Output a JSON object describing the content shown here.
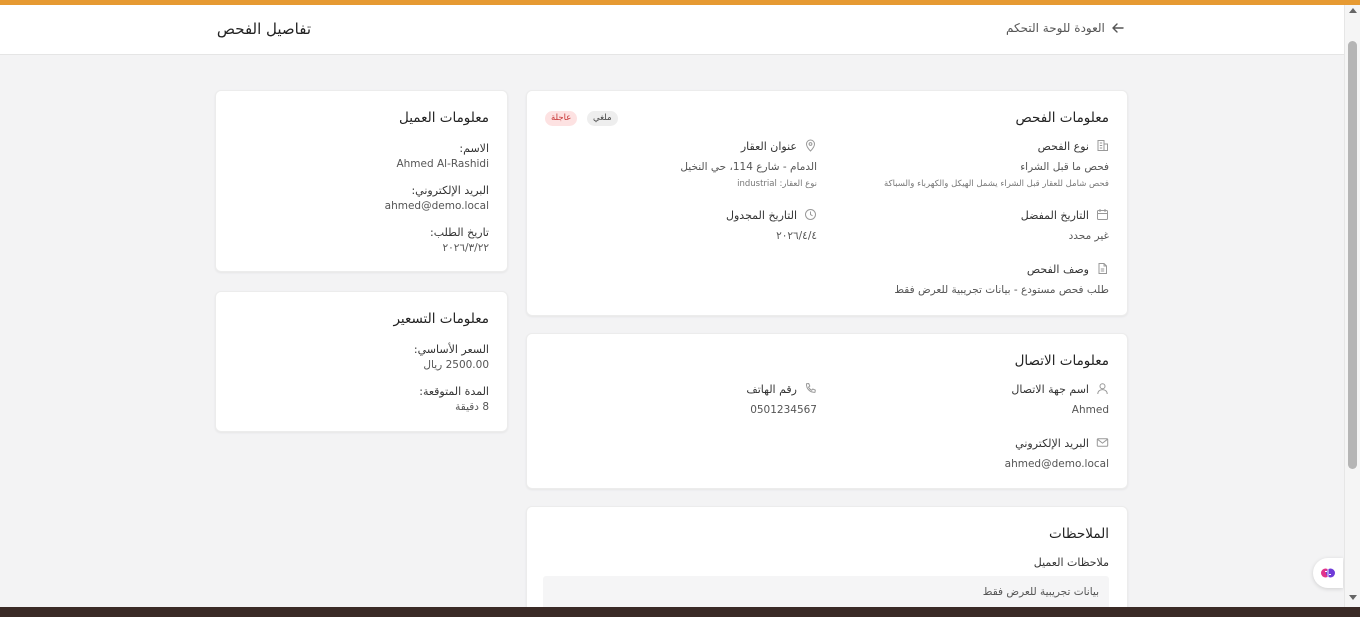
{
  "header": {
    "title": "تفاصيل الفحص",
    "back_label": "العودة للوحة التحكم"
  },
  "inspection_info": {
    "title": "معلومات الفحص",
    "status_badge": "ملغي",
    "priority_badge": "عاجلة",
    "type_label": "نوع الفحص",
    "type_value": "فحص ما قبل الشراء",
    "type_description": "فحص شامل للعقار قبل الشراء يشمل الهيكل والكهرباء والسباكة",
    "address_label": "عنوان العقار",
    "address_value": "الدمام - شارع 114، حي النخيل",
    "property_type": "نوع العقار: industrial",
    "preferred_date_label": "التاريخ المفضل",
    "preferred_date_value": "غير محدد",
    "scheduled_date_label": "التاريخ المجدول",
    "scheduled_date_value": "٢٠٢٦/٤/٤",
    "description_label": "وصف الفحص",
    "description_value": "طلب فحص مستودع - بيانات تجريبية للعرض فقط"
  },
  "contact_info": {
    "title": "معلومات الاتصال",
    "name_label": "اسم جهة الاتصال",
    "name_value": "Ahmed",
    "phone_label": "رقم الهاتف",
    "phone_value": "0501234567",
    "email_label": "البريد الإلكتروني",
    "email_value": "ahmed@demo.local"
  },
  "notes": {
    "title": "الملاحظات",
    "client_notes_label": "ملاحظات العميل",
    "client_notes_value": "بيانات تجريبية للعرض فقط"
  },
  "client_info": {
    "title": "معلومات العميل",
    "name_label": "الاسم:",
    "name_value": "Ahmed Al-Rashidi",
    "email_label": "البريد الإلكتروني:",
    "email_value": "ahmed@demo.local",
    "request_date_label": "تاريخ الطلب:",
    "request_date_value": "٢٠٢٦/٣/٢٢"
  },
  "pricing_info": {
    "title": "معلومات التسعير",
    "base_price_label": "السعر الأساسي:",
    "base_price_value": "2500.00 ريال",
    "duration_label": "المدة المتوقعة:",
    "duration_value": "8 دقيقة"
  },
  "colors": {
    "accent": "#e69a32",
    "urgent_text": "#c53030",
    "urgent_bg": "#fde2e2"
  }
}
